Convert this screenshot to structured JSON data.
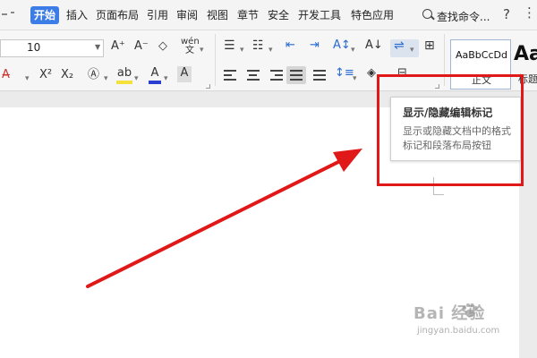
{
  "menu": {
    "tabs": [
      "开始",
      "插入",
      "页面布局",
      "引用",
      "审阅",
      "视图",
      "章节",
      "安全",
      "开发工具",
      "特色应用"
    ],
    "active_tab": "开始",
    "search_label": "查找命令...",
    "help": "?",
    "more": "⋮"
  },
  "ribbon": {
    "font_size": "10",
    "style_sample": "AaBbCcDd",
    "style_name": "正文",
    "style_sample2": "Aa",
    "style_name2": "标题"
  },
  "tooltip": {
    "title": "显示/隐藏编辑标记",
    "description": "显示或隐藏文档中的格式标记和段落布局按钮"
  },
  "watermark": {
    "brand": "Bai  经验",
    "url": "jingyan.baidu.com"
  },
  "colors": {
    "accent": "#3c7ce7",
    "annotation": "#e01818"
  },
  "icons": {
    "search": "search-icon",
    "help": "help-icon",
    "more": "more-icon",
    "paragraph_marks": "paragraph-marks-icon"
  }
}
